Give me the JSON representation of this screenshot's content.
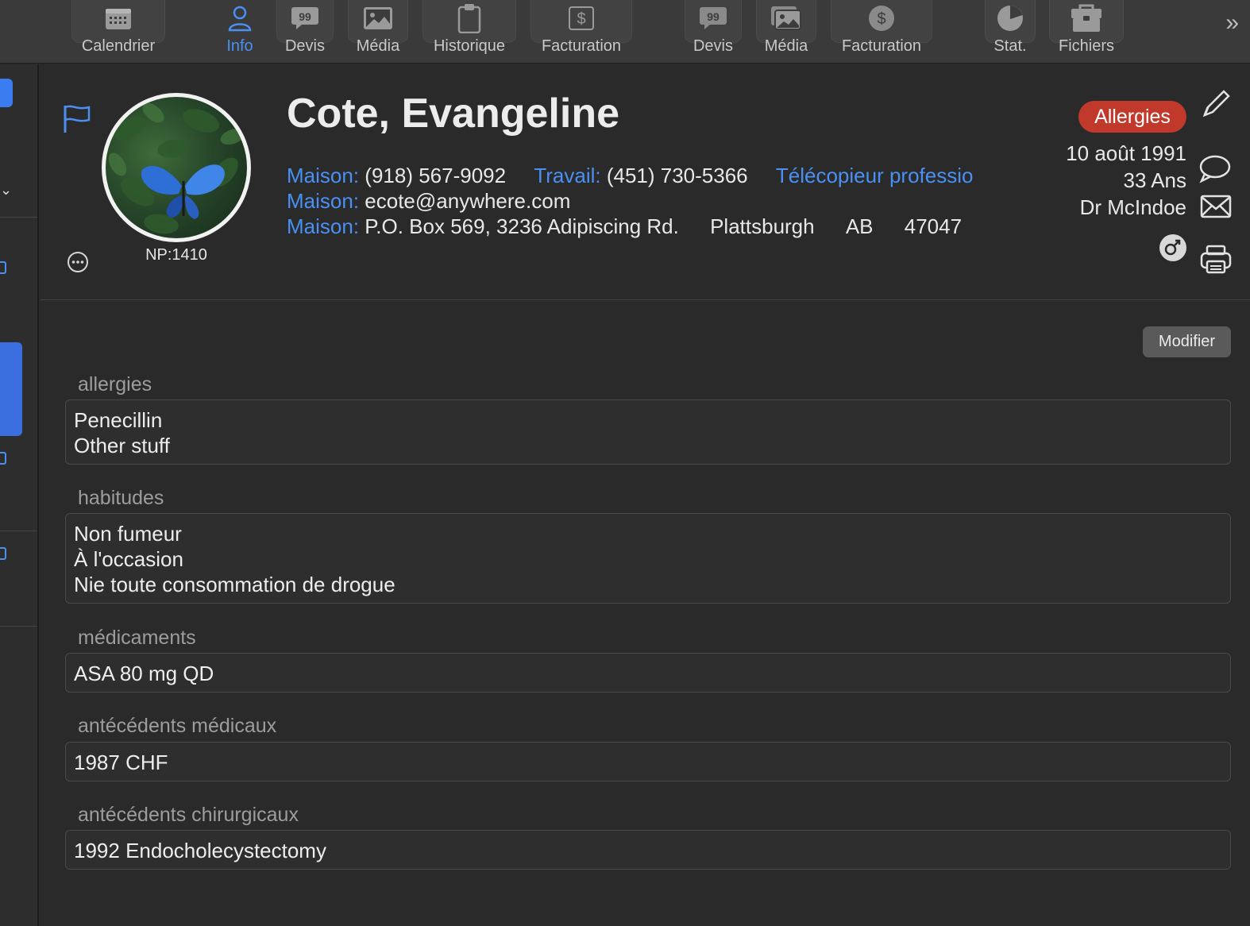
{
  "toolbar": {
    "calendrier": "Calendrier",
    "info": "Info",
    "devis1": "Devis",
    "media1": "Média",
    "historique": "Historique",
    "facturation1": "Facturation",
    "devis2": "Devis",
    "media2": "Média",
    "facturation2": "Facturation",
    "stat": "Stat.",
    "fichiers": "Fichiers",
    "accent_color": "#4a90f2"
  },
  "patient": {
    "name": "Cote, Evangeline",
    "np": "NP:1410",
    "phone_home_label": "Maison:",
    "phone_home": "(918) 567-9092",
    "phone_work_label": "Travail:",
    "phone_work": "(451) 730-5366",
    "fax_label": "Télécopieur professio",
    "email_label": "Maison:",
    "email": "ecote@anywhere.com",
    "address_label": "Maison:",
    "address": "P.O. Box 569, 3236 Adipiscing Rd.",
    "city": "Plattsburgh",
    "province": "AB",
    "postal": "47047",
    "allergy_badge": "Allergies",
    "allergy_badge_color": "#c0392b",
    "birthdate": "10 août 1991",
    "age": "33 Ans",
    "doctor": "Dr McIndoe"
  },
  "actions": {
    "modifier": "Modifier"
  },
  "fields": {
    "allergies": {
      "label": "allergies",
      "lines": [
        "Penecillin",
        "Other stuff"
      ]
    },
    "habitudes": {
      "label": "habitudes",
      "lines": [
        "Non fumeur",
        "À l'occasion",
        "Nie toute consommation de drogue"
      ]
    },
    "medicaments": {
      "label": "médicaments",
      "lines": [
        "ASA 80 mg QD"
      ]
    },
    "antecedents_medicaux": {
      "label": "antécédents médicaux",
      "lines": [
        "1987 CHF"
      ]
    },
    "antecedents_chirurgicaux": {
      "label": "antécédents chirurgicaux",
      "lines": [
        "1992 Endocholecystectomy"
      ]
    }
  }
}
